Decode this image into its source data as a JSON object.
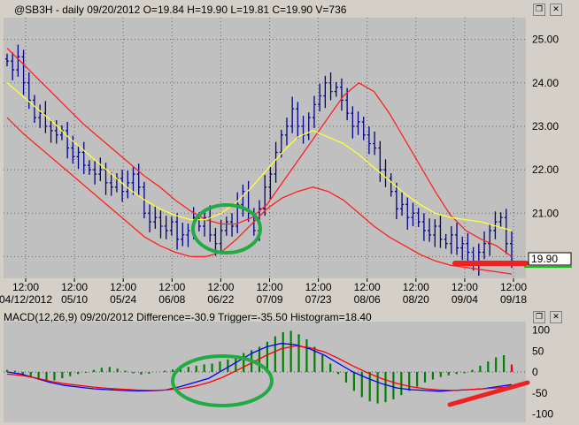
{
  "price_pane": {
    "title": "@SB3H - daily 09/20/2012 O=19.84 H=19.90 L=19.81 C=19.90 V=736",
    "last_price_label": "19.90"
  },
  "macd_pane": {
    "title": "MACD(12,26,9) 09/20/2012 Difference=-30.9 Trigger=-35.50 Histogram=18.40"
  },
  "icons": {
    "restore": "restore-icon",
    "close": "close-icon"
  },
  "colors": {
    "background": "#c0c0c0",
    "bars": "#00008b",
    "moving_average": "#ffff33",
    "bands": "#ff2020",
    "histogram": "#008000",
    "macd_line": "#0000ff",
    "trigger_line": "#ff0000",
    "highlight_circle": "#22aa44",
    "annotation_line": "#ee2222"
  },
  "chart_data": [
    {
      "type": "line",
      "title": "@SB3H - daily 09/20/2012 O=19.84 H=19.90 L=19.81 C=19.90 V=736",
      "x_labels": [
        {
          "t": "12:00",
          "d": "04/12/2012"
        },
        {
          "t": "12:00",
          "d": "05/10"
        },
        {
          "t": "12:00",
          "d": "05/24"
        },
        {
          "t": "12:00",
          "d": "06/08"
        },
        {
          "t": "12:00",
          "d": "06/22"
        },
        {
          "t": "12:00",
          "d": "07/09"
        },
        {
          "t": "12:00",
          "d": "07/23"
        },
        {
          "t": "12:00",
          "d": "08/06"
        },
        {
          "t": "12:00",
          "d": "08/20"
        },
        {
          "t": "12:00",
          "d": "09/04"
        },
        {
          "t": "12:00",
          "d": "09/18"
        }
      ],
      "y_ticks": [
        "25.00",
        "24.00",
        "23.00",
        "22.00",
        "21.00",
        "20.00"
      ],
      "ylim": [
        19.5,
        25.5
      ],
      "closes": [
        24.5,
        24.3,
        24.6,
        24.0,
        23.6,
        23.2,
        23.3,
        23.0,
        22.9,
        22.8,
        22.9,
        22.5,
        22.3,
        22.4,
        22.1,
        22.0,
        21.9,
        22.0,
        21.7,
        21.6,
        21.8,
        21.5,
        21.7,
        21.9,
        21.6,
        21.0,
        20.8,
        20.9,
        20.7,
        20.6,
        20.8,
        20.4,
        20.5,
        20.6,
        20.9,
        20.7,
        20.9,
        20.5,
        20.3,
        20.6,
        20.8,
        20.7,
        21.2,
        21.5,
        21.0,
        20.6,
        21.1,
        21.6,
        21.9,
        22.4,
        22.8,
        23.0,
        23.4,
        23.0,
        22.8,
        23.2,
        23.5,
        23.7,
        24.0,
        23.8,
        23.9,
        23.6,
        23.3,
        23.0,
        23.1,
        22.8,
        22.6,
        22.5,
        22.0,
        21.8,
        21.5,
        21.1,
        21.2,
        20.9,
        21.0,
        20.8,
        20.6,
        20.5,
        20.7,
        20.4,
        20.3,
        20.5,
        20.2,
        20.3,
        20.1,
        19.8,
        20.1,
        20.3,
        20.6,
        20.8,
        20.9,
        20.3,
        19.9
      ],
      "series": [
        {
          "values": [
            24.8,
            24.45,
            24.1,
            23.75,
            23.4,
            23.05,
            22.75,
            22.45,
            22.15,
            21.85,
            21.6,
            21.3,
            21.05,
            20.85,
            20.75,
            20.75,
            20.9,
            21.2,
            21.7,
            22.2,
            22.7,
            23.2,
            23.7,
            24.0,
            23.8,
            23.3,
            22.7,
            22.1,
            21.5,
            20.95,
            20.6,
            20.4,
            20.25,
            20.0
          ]
        },
        {
          "values": [
            24.0,
            23.7,
            23.4,
            23.1,
            22.75,
            22.45,
            22.15,
            21.85,
            21.55,
            21.3,
            21.1,
            20.95,
            20.85,
            20.85,
            21.0,
            21.25,
            21.6,
            22.0,
            22.4,
            22.75,
            22.9,
            22.75,
            22.6,
            22.35,
            22.05,
            21.75,
            21.45,
            21.2,
            21.0,
            20.9,
            20.85,
            20.8,
            20.7,
            20.6
          ]
        },
        {
          "values": [
            23.2,
            22.85,
            22.55,
            22.25,
            21.95,
            21.65,
            21.35,
            21.05,
            20.75,
            20.45,
            20.25,
            20.1,
            20.0,
            20.0,
            20.1,
            20.4,
            20.75,
            21.1,
            21.35,
            21.5,
            21.6,
            21.5,
            21.3,
            21.0,
            20.7,
            20.45,
            20.25,
            20.05,
            19.9,
            19.8,
            19.75,
            19.7,
            19.65,
            19.6
          ]
        }
      ]
    },
    {
      "type": "bar",
      "title": "MACD(12,26,9) 09/20/2012 Difference=-30.9 Trigger=-35.50 Histogram=18.40",
      "y_ticks": [
        "100",
        "50",
        "0",
        "-50",
        "-100"
      ],
      "ylim": [
        -120,
        120
      ],
      "histogram": [
        5,
        3,
        -8,
        -12,
        -18,
        -22,
        -20,
        -15,
        -10,
        -5,
        -2,
        5,
        10,
        12,
        8,
        3,
        -3,
        -6,
        -4,
        0,
        3,
        6,
        8,
        12,
        15,
        18,
        20,
        25,
        30,
        38,
        45,
        52,
        60,
        72,
        85,
        95,
        98,
        90,
        78,
        60,
        40,
        20,
        -5,
        -25,
        -45,
        -60,
        -70,
        -75,
        -72,
        -65,
        -55,
        -45,
        -35,
        -25,
        -18,
        -12,
        -8,
        -5,
        -3,
        5,
        15,
        25,
        35,
        40,
        18
      ],
      "series": [
        {
          "values": [
            0,
            -5,
            -15,
            -25,
            -32,
            -36,
            -40,
            -42,
            -44,
            -45,
            -45,
            -43,
            -35,
            -25,
            -15,
            5,
            25,
            45,
            60,
            68,
            65,
            55,
            40,
            20,
            0,
            -15,
            -28,
            -38,
            -42,
            -44,
            -46,
            -44,
            -42,
            -40,
            -35,
            -30
          ]
        },
        {
          "values": [
            -5,
            -8,
            -14,
            -22,
            -28,
            -32,
            -36,
            -39,
            -41,
            -43,
            -44,
            -43,
            -40,
            -34,
            -25,
            -12,
            5,
            22,
            40,
            55,
            62,
            58,
            48,
            32,
            14,
            -2,
            -16,
            -27,
            -35,
            -40,
            -43,
            -44,
            -42,
            -40,
            -38,
            -35
          ]
        }
      ]
    }
  ]
}
